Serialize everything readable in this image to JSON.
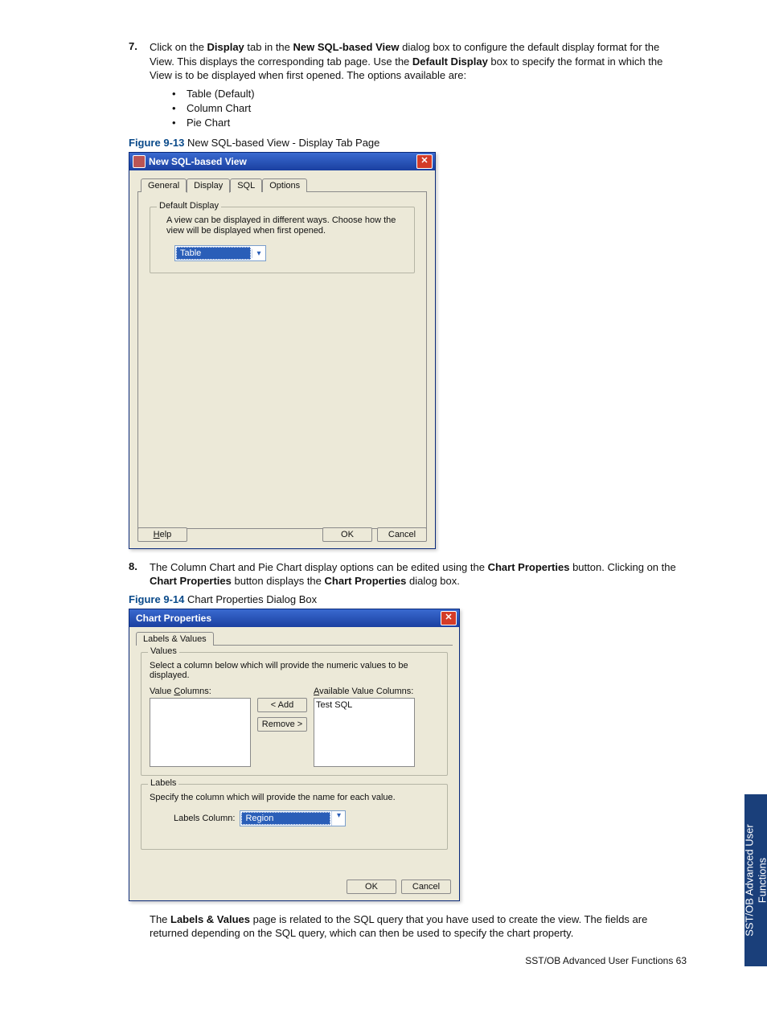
{
  "step7": {
    "num": "7.",
    "text_parts": [
      "Click on the ",
      " tab in the ",
      " dialog box to configure the default display format for the View.  This displays the corresponding tab page.  Use the ",
      " box to specify the format in which the View is to be displayed when first opened.  The options available are:"
    ],
    "bold": [
      "Display",
      "New SQL-based View",
      "Default Display"
    ]
  },
  "bullets7": [
    "Table (Default)",
    "Column Chart",
    "Pie Chart"
  ],
  "fig913": {
    "num": "Figure 9-13",
    "title": " New SQL-based View - Display Tab Page"
  },
  "dialog1": {
    "title": "New SQL-based View",
    "tabs": [
      "General",
      "Display",
      "SQL",
      "Options"
    ],
    "group_legend": "Default Display",
    "helptext": "A view can be displayed in different ways. Choose how the view will be displayed when first opened.",
    "combo_value": "Table",
    "help_btn": "Help",
    "ok_btn": "OK",
    "cancel_btn": "Cancel"
  },
  "step8": {
    "num": "8.",
    "text_parts": [
      "The Column Chart and Pie Chart display options can be edited using the ",
      " button.  Clicking on the ",
      " button displays the ",
      " dialog box."
    ],
    "bold": [
      "Chart Properties",
      "Chart Properties",
      "Chart Properties"
    ]
  },
  "fig914": {
    "num": "Figure 9-14",
    "title": " Chart Properties Dialog Box"
  },
  "dialog2": {
    "title": "Chart Properties",
    "tab": "Labels & Values",
    "values_legend": "Values",
    "values_help": "Select a column below which will provide the numeric values to be displayed.",
    "value_cols_label": "Value Columns:",
    "avail_cols_label": "Available Value Columns:",
    "avail_item": "Test SQL",
    "add_btn": "< Add",
    "remove_btn": "Remove >",
    "labels_legend": "Labels",
    "labels_help": "Specify the column which will provide the name for each value.",
    "labels_col_label": "Labels Column:",
    "labels_combo": "Region",
    "ok_btn": "OK",
    "cancel_btn": "Cancel"
  },
  "body_para": {
    "parts": [
      "The ",
      " page is related to the SQL query that you have used to create the view.  The fields are returned depending on the SQL query, which can then be used to specify the chart property."
    ],
    "bold": "Labels & Values"
  },
  "footer": "SST/OB Advanced User Functions   63",
  "sidetab": "SST/OB Advanced User\nFunctions"
}
